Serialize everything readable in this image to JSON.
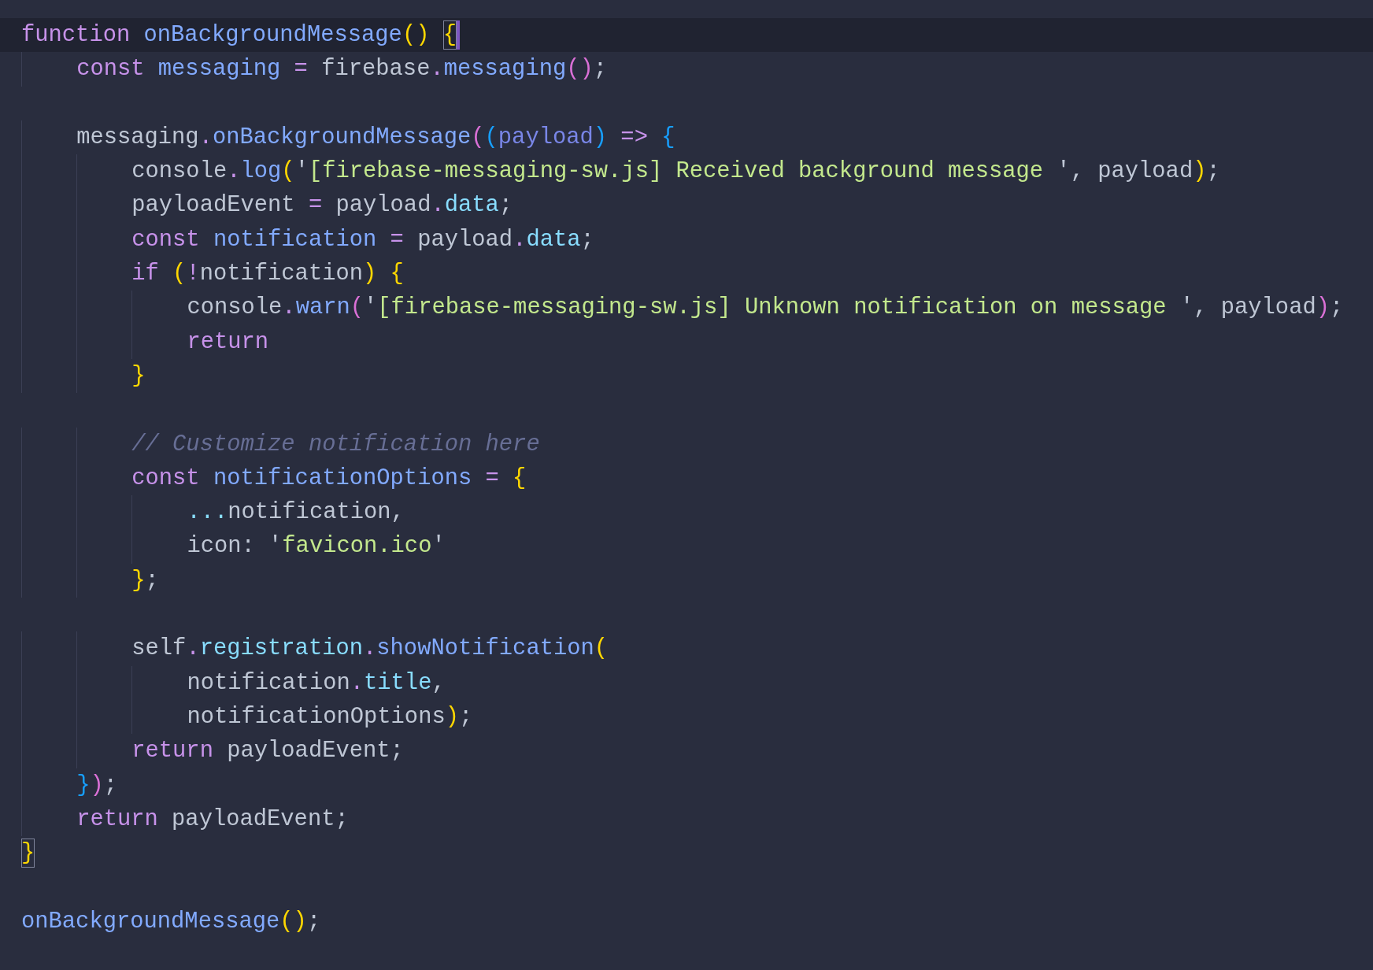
{
  "editor": {
    "lines": [
      {
        "kind": "code",
        "current": true,
        "tokens": [
          {
            "text": "function",
            "kind": "kw"
          },
          {
            "text": " onBackgroundMessage",
            "kind": "fn"
          },
          {
            "text": "()",
            "kind": "b1"
          },
          {
            "text": " {",
            "kind": "b1",
            "matched": true
          }
        ]
      },
      {
        "kind": "code",
        "tokens": [
          {
            "text": "    const",
            "kind": "kw"
          },
          {
            "text": " messaging",
            "kind": "fn"
          },
          {
            "text": " =",
            "kind": "op"
          },
          {
            "text": " firebase",
            "kind": "plain"
          },
          {
            "text": ".",
            "kind": "op"
          },
          {
            "text": "messaging",
            "kind": "fn"
          },
          {
            "text": "()",
            "kind": "b2"
          },
          {
            "text": ";",
            "kind": "plain"
          }
        ]
      },
      {
        "kind": "blank"
      },
      {
        "kind": "code",
        "tokens": [
          {
            "text": "    messaging",
            "kind": "plain"
          },
          {
            "text": ".",
            "kind": "op"
          },
          {
            "text": "onBackgroundMessage",
            "kind": "fn"
          },
          {
            "text": "(",
            "kind": "b2"
          },
          {
            "text": "(",
            "kind": "b3"
          },
          {
            "text": "payload",
            "kind": "param"
          },
          {
            "text": ")",
            "kind": "b3"
          },
          {
            "text": " =>",
            "kind": "op"
          },
          {
            "text": " {",
            "kind": "b3"
          }
        ]
      },
      {
        "kind": "code",
        "tokens": [
          {
            "text": "        console",
            "kind": "plain"
          },
          {
            "text": ".",
            "kind": "op"
          },
          {
            "text": "log",
            "kind": "fn"
          },
          {
            "text": "(",
            "kind": "b1"
          },
          {
            "text": "'",
            "kind": "plain"
          },
          {
            "text": "[firebase-messaging-sw.js] Received background message ",
            "kind": "str"
          },
          {
            "text": "', payload",
            "kind": "plain"
          },
          {
            "text": ")",
            "kind": "b1"
          },
          {
            "text": ";",
            "kind": "plain"
          }
        ]
      },
      {
        "kind": "code",
        "tokens": [
          {
            "text": "        payloadEvent",
            "kind": "plain"
          },
          {
            "text": " =",
            "kind": "op"
          },
          {
            "text": " payload",
            "kind": "plain"
          },
          {
            "text": ".",
            "kind": "op"
          },
          {
            "text": "data",
            "kind": "prop"
          },
          {
            "text": ";",
            "kind": "plain"
          }
        ]
      },
      {
        "kind": "code",
        "tokens": [
          {
            "text": "        const",
            "kind": "kw"
          },
          {
            "text": " notification",
            "kind": "fn"
          },
          {
            "text": " =",
            "kind": "op"
          },
          {
            "text": " payload",
            "kind": "plain"
          },
          {
            "text": ".",
            "kind": "op"
          },
          {
            "text": "data",
            "kind": "prop"
          },
          {
            "text": ";",
            "kind": "plain"
          }
        ]
      },
      {
        "kind": "code",
        "tokens": [
          {
            "text": "        if",
            "kind": "kw"
          },
          {
            "text": " (",
            "kind": "b1"
          },
          {
            "text": "!",
            "kind": "op"
          },
          {
            "text": "notification",
            "kind": "plain"
          },
          {
            "text": ")",
            "kind": "b1"
          },
          {
            "text": " {",
            "kind": "b1"
          }
        ]
      },
      {
        "kind": "code",
        "tokens": [
          {
            "text": "            console",
            "kind": "plain"
          },
          {
            "text": ".",
            "kind": "op"
          },
          {
            "text": "warn",
            "kind": "fn"
          },
          {
            "text": "(",
            "kind": "b2"
          },
          {
            "text": "'",
            "kind": "plain"
          },
          {
            "text": "[firebase-messaging-sw.js] Unknown notification on message ",
            "kind": "str"
          },
          {
            "text": "', payload",
            "kind": "plain"
          },
          {
            "text": ")",
            "kind": "b2"
          },
          {
            "text": ";",
            "kind": "plain"
          }
        ]
      },
      {
        "kind": "code",
        "tokens": [
          {
            "text": "            return",
            "kind": "kw"
          }
        ]
      },
      {
        "kind": "code",
        "tokens": [
          {
            "text": "        }",
            "kind": "b1"
          }
        ]
      },
      {
        "kind": "blank"
      },
      {
        "kind": "code",
        "tokens": [
          {
            "text": "        // Customize notification here",
            "kind": "comment"
          }
        ]
      },
      {
        "kind": "code",
        "tokens": [
          {
            "text": "        const",
            "kind": "kw"
          },
          {
            "text": " notificationOptions",
            "kind": "fn"
          },
          {
            "text": " =",
            "kind": "op"
          },
          {
            "text": " {",
            "kind": "b1"
          }
        ]
      },
      {
        "kind": "code",
        "tokens": [
          {
            "text": "            ...",
            "kind": "prop"
          },
          {
            "text": "notification,",
            "kind": "plain"
          }
        ]
      },
      {
        "kind": "code",
        "tokens": [
          {
            "text": "            icon: '",
            "kind": "plain"
          },
          {
            "text": "favicon.ico",
            "kind": "str"
          },
          {
            "text": "'",
            "kind": "plain"
          }
        ]
      },
      {
        "kind": "code",
        "tokens": [
          {
            "text": "        }",
            "kind": "b1"
          },
          {
            "text": ";",
            "kind": "plain"
          }
        ]
      },
      {
        "kind": "blank"
      },
      {
        "kind": "code",
        "tokens": [
          {
            "text": "        self",
            "kind": "plain"
          },
          {
            "text": ".",
            "kind": "op"
          },
          {
            "text": "registration",
            "kind": "prop"
          },
          {
            "text": ".",
            "kind": "op"
          },
          {
            "text": "showNotification",
            "kind": "fn"
          },
          {
            "text": "(",
            "kind": "b1"
          }
        ]
      },
      {
        "kind": "code",
        "tokens": [
          {
            "text": "            notification",
            "kind": "plain"
          },
          {
            "text": ".",
            "kind": "op"
          },
          {
            "text": "title",
            "kind": "prop"
          },
          {
            "text": ",",
            "kind": "plain"
          }
        ]
      },
      {
        "kind": "code",
        "tokens": [
          {
            "text": "            notificationOptions",
            "kind": "plain"
          },
          {
            "text": ")",
            "kind": "b1"
          },
          {
            "text": ";",
            "kind": "plain"
          }
        ]
      },
      {
        "kind": "code",
        "tokens": [
          {
            "text": "        return",
            "kind": "kw"
          },
          {
            "text": " payloadEvent;",
            "kind": "plain"
          }
        ]
      },
      {
        "kind": "code",
        "tokens": [
          {
            "text": "    }",
            "kind": "b3"
          },
          {
            "text": ")",
            "kind": "b2"
          },
          {
            "text": ";",
            "kind": "plain"
          }
        ]
      },
      {
        "kind": "code",
        "tokens": [
          {
            "text": "    return",
            "kind": "kw"
          },
          {
            "text": " payloadEvent;",
            "kind": "plain"
          }
        ]
      },
      {
        "kind": "code",
        "tokens": [
          {
            "text": "}",
            "kind": "b1",
            "matched": true
          }
        ]
      },
      {
        "kind": "blank"
      },
      {
        "kind": "code",
        "tokens": [
          {
            "text": "onBackgroundMessage",
            "kind": "fn"
          },
          {
            "text": "()",
            "kind": "b1"
          },
          {
            "text": ";",
            "kind": "plain"
          }
        ]
      }
    ]
  }
}
